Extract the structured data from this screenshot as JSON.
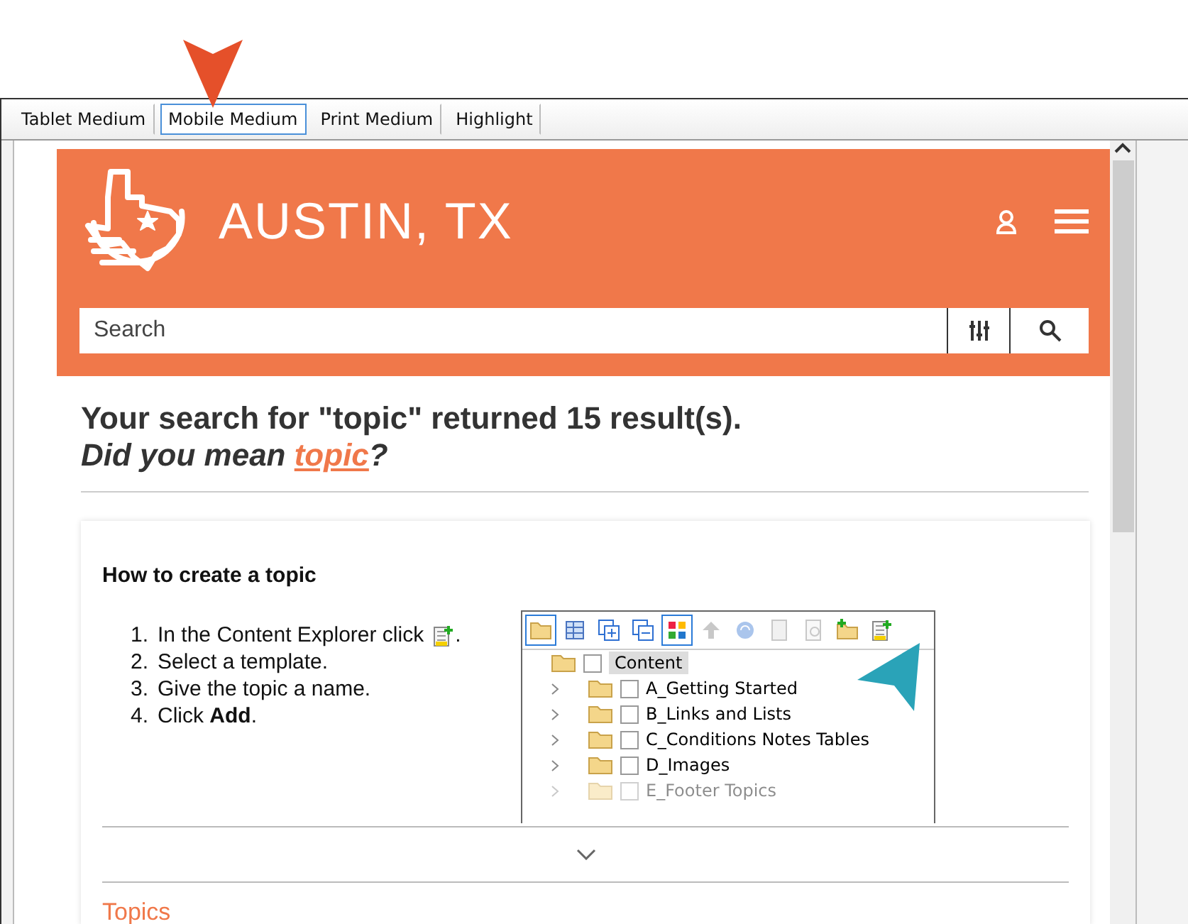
{
  "tabs": [
    {
      "label": "Tablet Medium",
      "selected": false
    },
    {
      "label": "Mobile Medium",
      "selected": true
    },
    {
      "label": "Print Medium",
      "selected": false
    },
    {
      "label": "Highlight",
      "selected": false
    }
  ],
  "header": {
    "site_title": "AUSTIN, TX",
    "search": {
      "placeholder": "Search"
    }
  },
  "results": {
    "summary": "Your search for \"topic\" returned 15 result(s).",
    "suggestion_prefix": "Did you mean ",
    "suggestion_link": "topic",
    "suggestion_suffix": "?"
  },
  "card": {
    "title": "How to create a topic",
    "steps": [
      {
        "number": "1.",
        "text": "In the Content Explorer click",
        "icon": true,
        "suffix": "."
      },
      {
        "number": "2.",
        "text": "Select a template.",
        "icon": false
      },
      {
        "number": "3.",
        "text": "Give the topic a name.",
        "icon": false
      },
      {
        "number": "4.",
        "text": "Click **Add**.",
        "icon": false
      }
    ],
    "explorer": {
      "toolbar": [
        {
          "kind": "folder",
          "selected": true,
          "disabled": false
        },
        {
          "kind": "grid",
          "selected": false,
          "disabled": false
        },
        {
          "kind": "expand",
          "selected": false,
          "disabled": false
        },
        {
          "kind": "collapse",
          "selected": false,
          "disabled": false
        },
        {
          "kind": "tiles",
          "selected": true,
          "disabled": false
        },
        {
          "kind": "up",
          "selected": false,
          "disabled": true
        },
        {
          "kind": "sync",
          "selected": false,
          "disabled": true
        },
        {
          "kind": "doc",
          "selected": false,
          "disabled": true
        },
        {
          "kind": "tool",
          "selected": false,
          "disabled": true
        },
        {
          "kind": "newfolder",
          "selected": false,
          "disabled": false
        },
        {
          "kind": "newtopic",
          "selected": false,
          "disabled": false
        }
      ],
      "root": {
        "label": "Content",
        "selected": true,
        "checked": false,
        "children": [
          {
            "label": "A_Getting Started",
            "faded": false,
            "checked": false
          },
          {
            "label": "B_Links and Lists",
            "faded": false,
            "checked": false
          },
          {
            "label": "C_Conditions Notes Tables",
            "faded": false,
            "checked": false
          },
          {
            "label": "D_Images",
            "faded": false,
            "checked": false
          },
          {
            "label": "E_Footer Topics",
            "faded": true,
            "checked": false
          }
        ]
      }
    }
  },
  "section_heading": "Topics"
}
